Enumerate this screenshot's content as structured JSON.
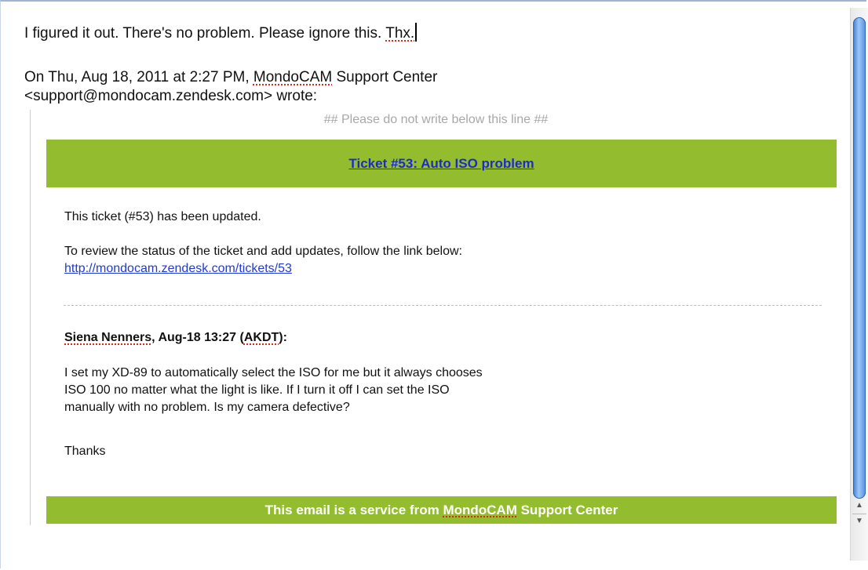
{
  "reply": {
    "message_parts": [
      "I figured it out. There's no problem. Please ignore this. ",
      "Thx."
    ],
    "attribution_line1_prefix": "On Thu, Aug 18, 2011 at 2:27 PM, ",
    "attribution_brand": "MondoCAM",
    "attribution_line1_suffix": " Support Center",
    "attribution_line2": "<support@mondocam.zendesk.com> wrote:"
  },
  "quoted": {
    "separator": "## Please do not write below this line ##",
    "ticket_title": "Ticket #53: Auto ISO problem",
    "updated_text": "This ticket (#53) has been updated.",
    "review_text": "To review the status of the ticket and add updates, follow the link below:",
    "ticket_url": "http://mondocam.zendesk.com/tickets/53",
    "author_name": "Siena Nenners",
    "author_mid": ", Aug-18 13:27 (",
    "author_tz": "AKDT",
    "author_end": "):",
    "comment_lines": [
      "I set my XD-89 to automatically select the ISO for me but it always chooses",
      "ISO 100 no matter what the light is like. If I turn it off I can set the ISO",
      "manually with no problem. Is my camera defective?"
    ],
    "closing": "Thanks",
    "footer_prefix": "This email is a service from ",
    "footer_brand": "MondoCAM",
    "footer_suffix": " Support Center"
  },
  "scrollbar": {
    "up_arrow": "▲",
    "down_arrow": "▼"
  },
  "colors": {
    "banner_green": "#93bd2e",
    "link_blue": "#1f3ad8",
    "spellcheck_red": "#e0231c"
  }
}
